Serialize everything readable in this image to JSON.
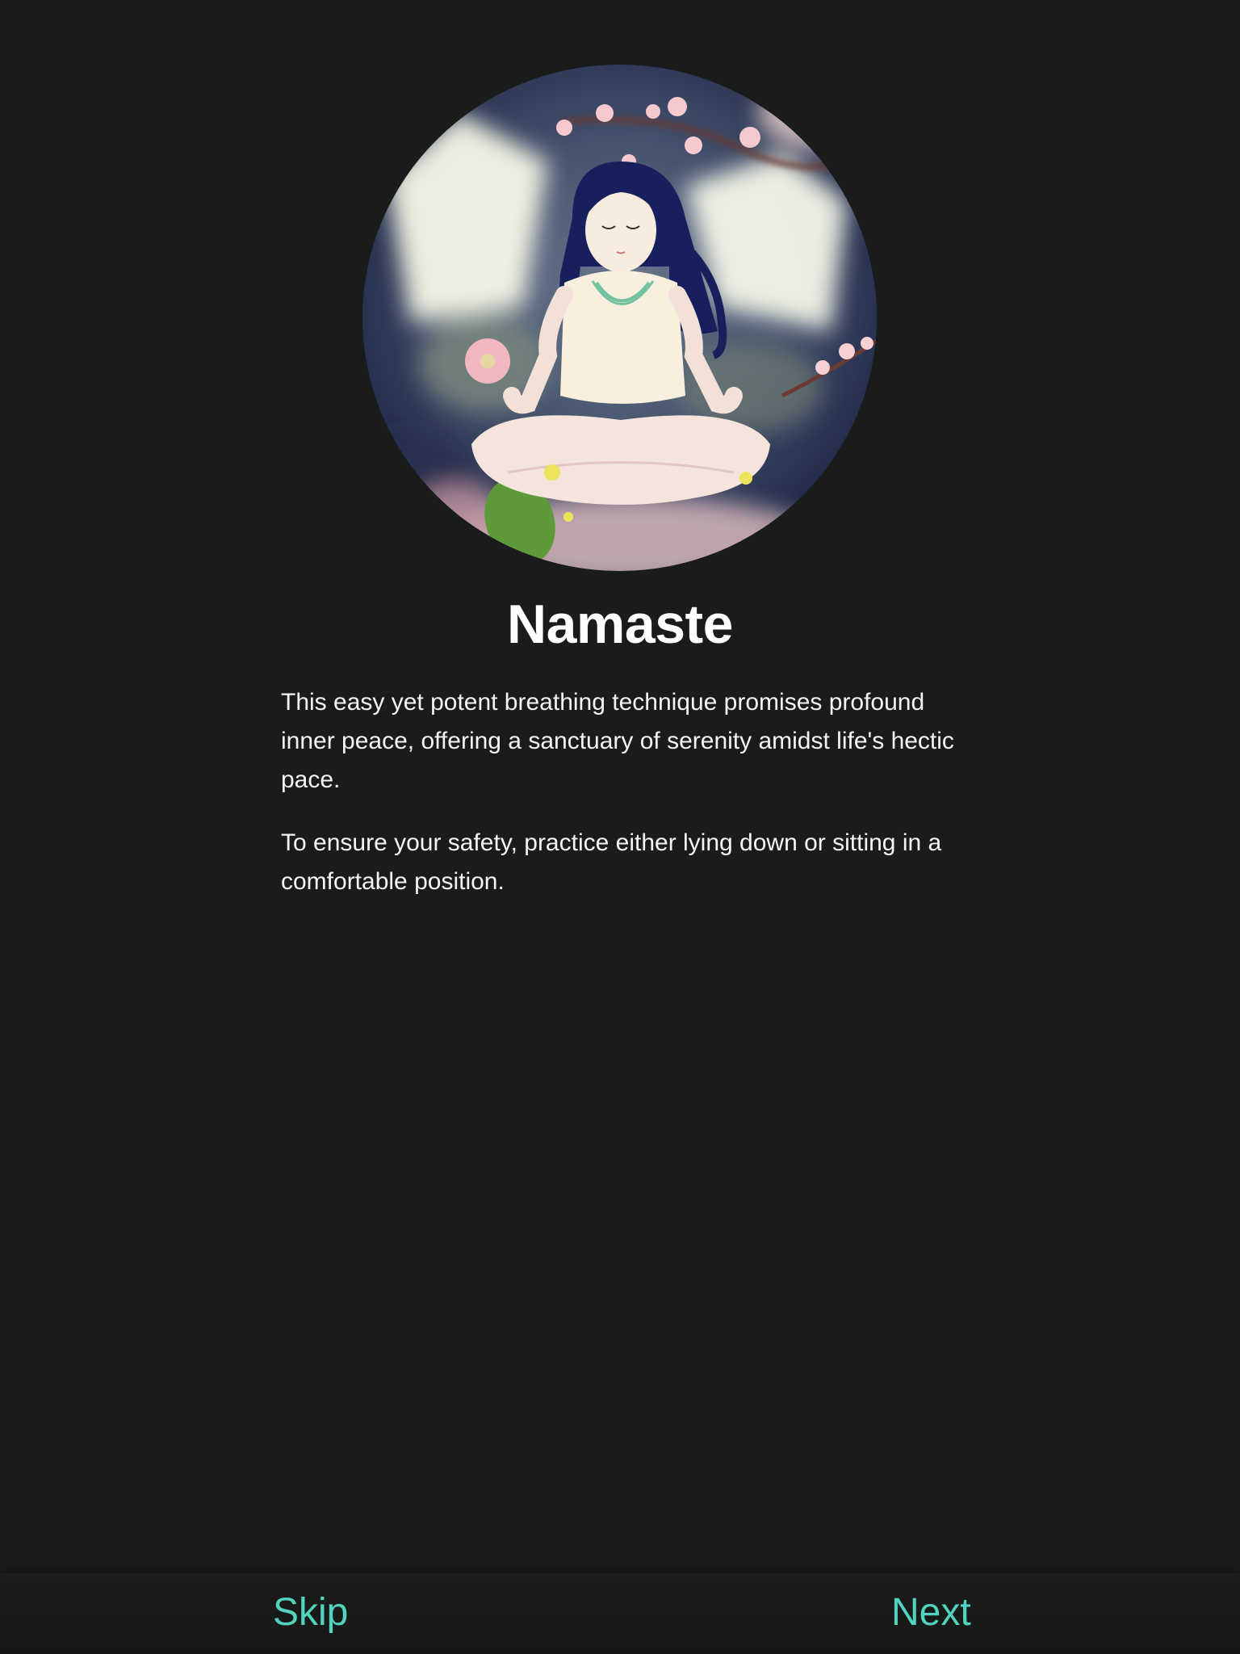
{
  "hero": {
    "image_description_name": "meditation-illustration"
  },
  "content": {
    "title": "Namaste",
    "paragraph_1": "This easy yet potent breathing technique promises profound inner peace, offering a sanctuary of serenity amidst life's hectic pace.",
    "paragraph_2": "To ensure your safety, practice either lying down or sitting in a comfortable position."
  },
  "navigation": {
    "skip_label": "Skip",
    "next_label": "Next"
  },
  "colors": {
    "background": "#1a1b1b",
    "accent": "#52d3bd",
    "text": "#ffffff"
  }
}
